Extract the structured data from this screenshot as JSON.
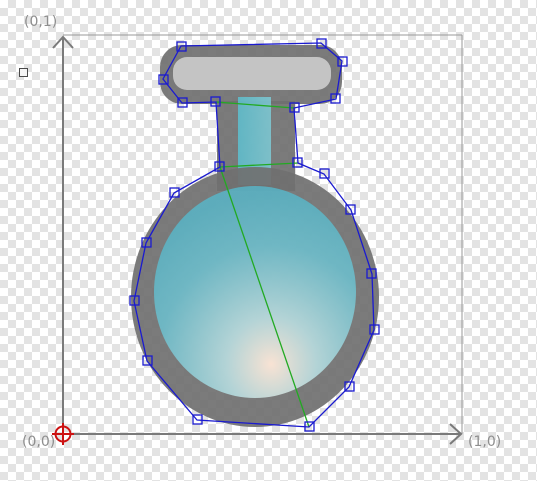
{
  "axes": {
    "top_label": "(0,1)",
    "origin_label": "(0,0)",
    "right_label": "(1,0)"
  },
  "colors": {
    "frame": "#9a9a9a",
    "axis": "#7a7a7a",
    "outline": "#1a1ad0",
    "pivot_line": "#22aa22",
    "origin_marker": "#cc1111",
    "sprite_border": "#707070",
    "liquid": "#6cc8d8"
  },
  "icons": {
    "origin": "origin-crosshair-icon",
    "toggle": "square-toggle-icon"
  },
  "polygon_handles": 25
}
